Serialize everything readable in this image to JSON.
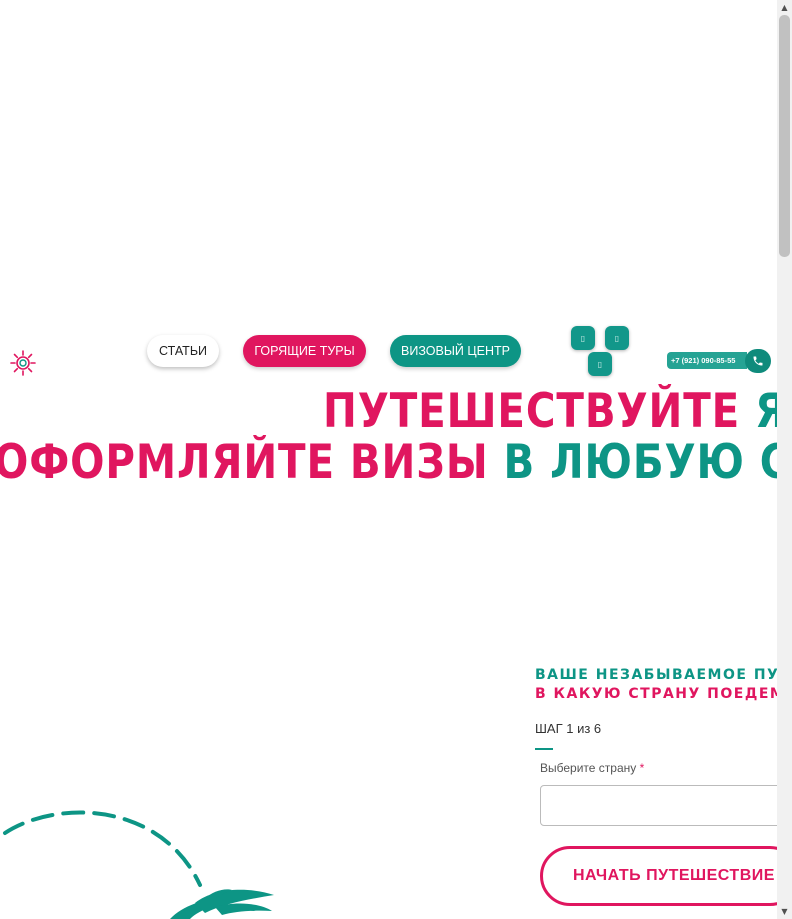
{
  "nav": {
    "articles": "СТАТЬИ",
    "hot_tours": "ГОРЯЩИЕ ТУРЫ",
    "visa_center": "ВИЗОВЫЙ ЦЕНТР"
  },
  "contact": {
    "phone": "+7 (921) 090-85-55"
  },
  "headline": {
    "line1_part1": "ПУТЕШЕСТВУЙТЕ",
    "line1_part2": "ЯРКО",
    "line2_part1": "ОФОРМЛЯЙТЕ ВИЗЫ",
    "line2_part2": "В ЛЮБУЮ СТРАНУ"
  },
  "form": {
    "subtitle1": "ВАШЕ НЕЗАБЫВАЕМОЕ ПУТЕШЕСТВИЕ",
    "subtitle2": "В КАКУЮ СТРАНУ ПОЕДЕМ?",
    "step": "ШАГ 1 из 6",
    "country_label": "Выберите страну",
    "required_mark": "*",
    "start_button": "НАЧАТЬ ПУТЕШЕСТВИЕ"
  },
  "colors": {
    "pink": "#e0165f",
    "teal": "#0d9585"
  },
  "icons": {
    "logo": "sun-icon",
    "social_1": "social-icon",
    "social_2": "social-icon",
    "social_3": "social-icon",
    "phone": "phone-icon",
    "scroll_up": "arrow-up-icon",
    "scroll_down": "arrow-down-icon"
  }
}
